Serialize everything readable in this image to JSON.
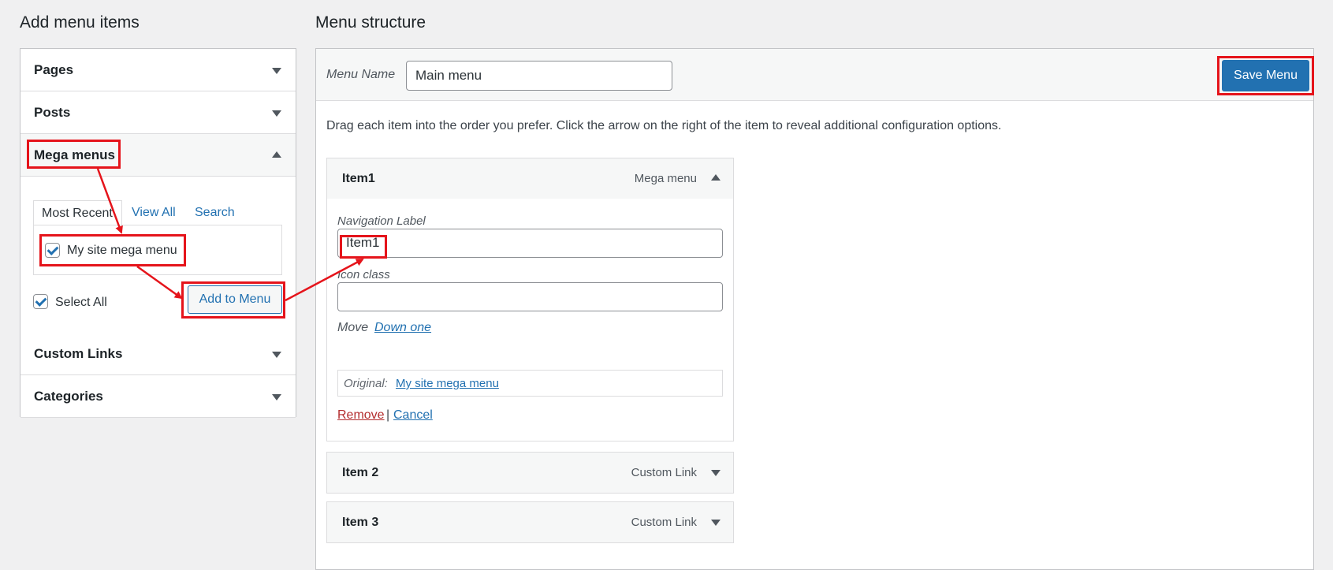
{
  "left": {
    "title": "Add menu items",
    "sections": [
      {
        "label": "Pages",
        "state": "collapsed"
      },
      {
        "label": "Posts",
        "state": "collapsed"
      },
      {
        "label": "Mega menus",
        "state": "expanded"
      },
      {
        "label": "Custom Links",
        "state": "collapsed"
      },
      {
        "label": "Categories",
        "state": "collapsed"
      }
    ],
    "tabs": {
      "most_recent": "Most Recent",
      "view_all": "View All",
      "search": "Search"
    },
    "checklist_item": {
      "label": "My site mega menu",
      "checked": true
    },
    "select_all": {
      "label": "Select All",
      "checked": true
    },
    "add_button": "Add to Menu"
  },
  "right": {
    "title": "Menu structure",
    "menu_name_label": "Menu Name",
    "menu_name_value": "Main menu",
    "save_button": "Save Menu",
    "instructions": "Drag each item into the order you prefer. Click the arrow on the right of the item to reveal additional configuration options.",
    "items": [
      {
        "title": "Item1",
        "type": "Mega menu",
        "state": "expanded"
      },
      {
        "title": "Item 2",
        "type": "Custom Link",
        "state": "collapsed"
      },
      {
        "title": "Item 3",
        "type": "Custom Link",
        "state": "collapsed"
      }
    ],
    "settings": {
      "nav_label": "Navigation Label",
      "nav_value": "Item1",
      "icon_label": "Icon class",
      "icon_value": "",
      "move_label": "Move",
      "move_link": "Down one",
      "original_label": "Original:",
      "original_link": "My site mega menu",
      "remove": "Remove",
      "separator": "|",
      "cancel": "Cancel"
    }
  },
  "colors": {
    "accent": "#2271b1",
    "highlight": "#e5141b",
    "danger": "#b32d2e",
    "background": "#f0f0f1"
  },
  "icons": [
    "chevron-down-icon",
    "chevron-up-icon",
    "checkmark-icon",
    "arrow-annotation"
  ]
}
